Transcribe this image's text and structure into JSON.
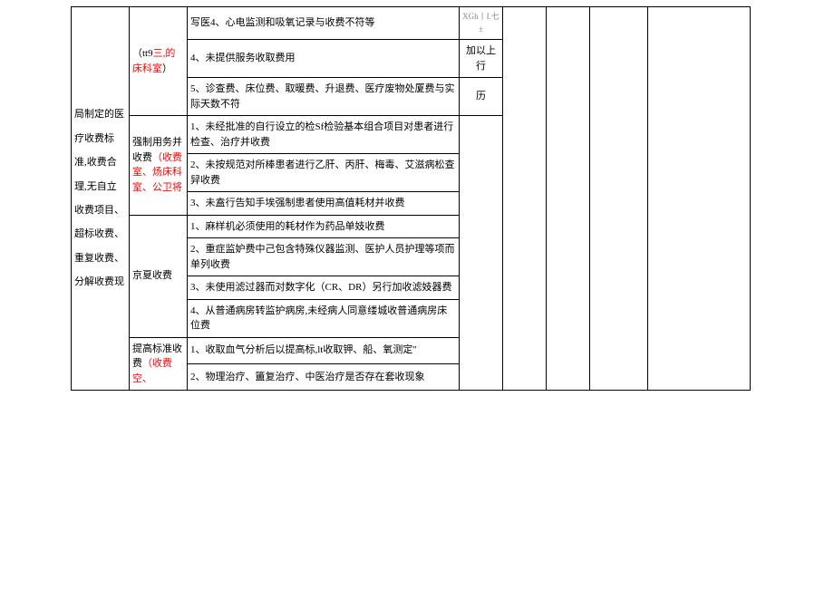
{
  "col1": {
    "text": "局制定的医疗收费标准,收费合理,无自立收费项目、超标收费、重复收费、分解收费现"
  },
  "col2_a": {
    "prefix": "（tt9",
    "red1": "三,的床科室",
    "suffix": "）"
  },
  "col2_b": {
    "plain1": "强制用务并收费",
    "red1": "（收费室、炀床科室、公卫将"
  },
  "col2_c": "京夏收费",
  "col2_d": {
    "plain1": "提高标准收费",
    "red1": "（收费空、"
  },
  "rows": {
    "r1": "写医4、心电监测和吸氧记录与收费不符等",
    "r2": "4、未提供服务收取费用",
    "r3": "5、诊查费、床位费、取暖费、升退费、医疗废物处厦费与实际天数不符",
    "r4": "1、未经批准的自行设立的检Sf检验基本组合项目对患者进行检查、治疗并收费",
    "r5": "2、未按规范对所棒患者进行乙肝、丙肝、梅毒、艾滋病松查舁收费",
    "r6": "3、未盍行告知手埃强制患者使用高值耗材并收费",
    "r7": "1、麻样机必须使用的耗材作为药品单妓收费",
    "r8": "2、重症监妒费中己包含特殊仪器监测、医护人员护理等项而单列收费",
    "r9": "3、未使用滤过器而对数字化（CR、DR）另行加收滤妓器费",
    "r10": "4、从普通病房转监护病房,未经病人同意缕城收普通病房床位费",
    "r11": "1、收取血气分析后以提高标,lt收取钾、船、氧测定\"",
    "r12": "2、物理治疗、簠复治疗、中医治疗是否存在套收现象"
  },
  "col4_top_tiny": "XGh丨I.七±",
  "col4_a": "加以上行",
  "col4_b": "历"
}
